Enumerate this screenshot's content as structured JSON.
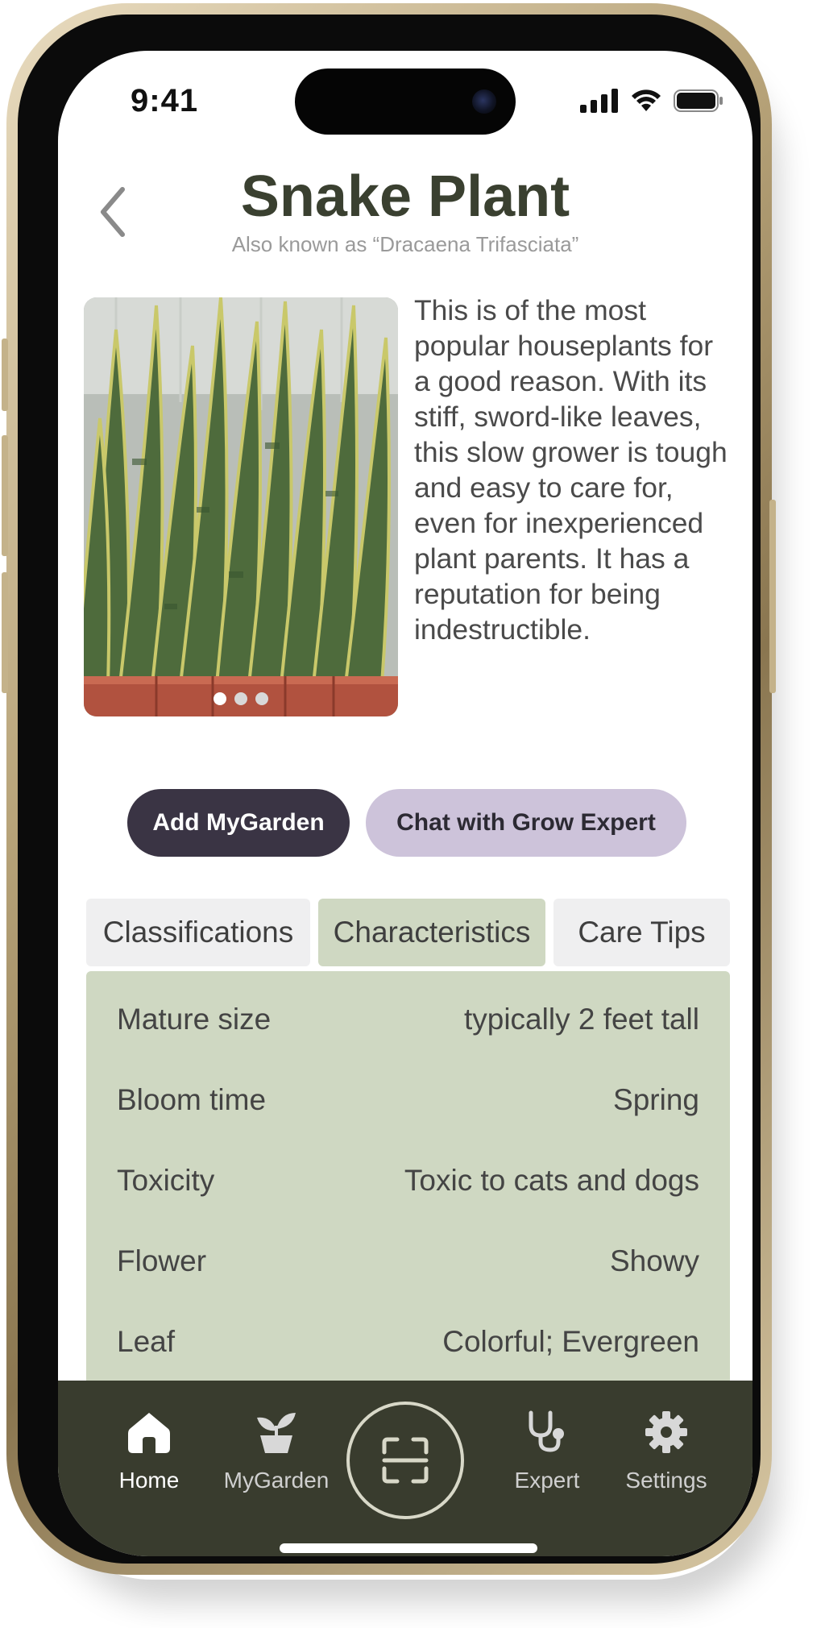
{
  "status": {
    "time": "9:41"
  },
  "header": {
    "title": "Snake Plant",
    "subtitle": "Also known as “Dracaena Trifasciata”"
  },
  "description": "This is of the most popular houseplants for a good reason. With its stiff, sword-like leaves, this slow grower is tough and easy to care for, even for inexperienced plant parents. It has a reputation for being indestructible.",
  "carousel": {
    "current": 1,
    "total": 3
  },
  "actions": {
    "add_label": "Add MyGarden",
    "chat_label": "Chat with Grow Expert"
  },
  "tabs": [
    {
      "label": "Classifications"
    },
    {
      "label": "Characteristics"
    },
    {
      "label": "Care Tips"
    }
  ],
  "characteristics": [
    {
      "key": "Mature size",
      "value": "typically 2 feet tall"
    },
    {
      "key": "Bloom time",
      "value": "Spring"
    },
    {
      "key": "Toxicity",
      "value": "Toxic to cats and dogs"
    },
    {
      "key": "Flower",
      "value": "Showy"
    },
    {
      "key": "Leaf",
      "value": "Colorful; Evergreen"
    }
  ],
  "nav": {
    "home": "Home",
    "mygarden": "MyGarden",
    "expert": "Expert",
    "settings": "Settings"
  },
  "colors": {
    "title": "#3a4030",
    "accent_dark": "#3a3444",
    "accent_light": "#cdc3da",
    "panel": "#cfd8c2",
    "nav_bg": "#393c2e"
  }
}
